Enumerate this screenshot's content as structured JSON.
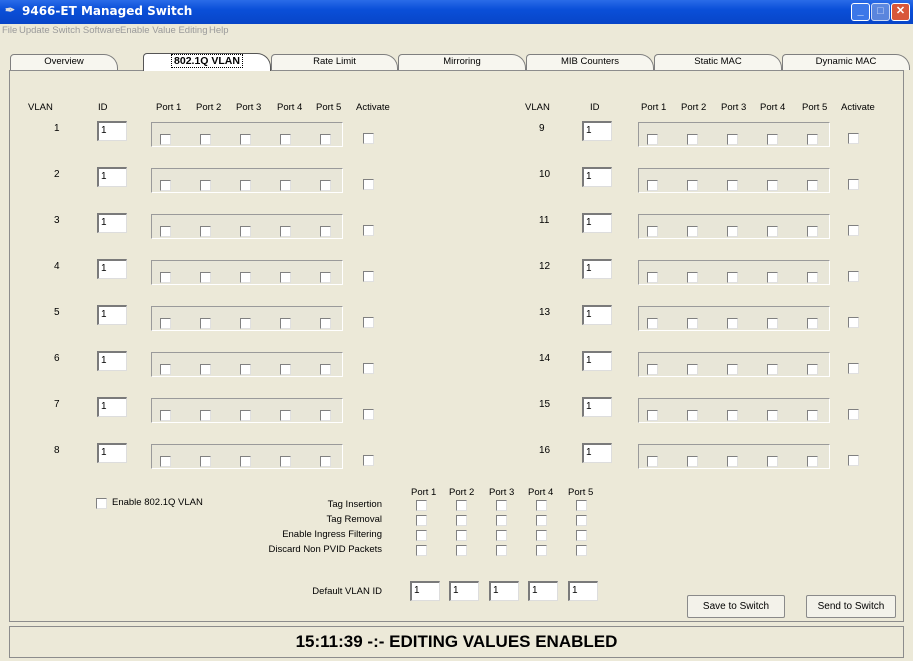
{
  "window": {
    "title": "9466-ET Managed Switch"
  },
  "menu": [
    "File",
    "Update Switch Software",
    "Enable Value Editing",
    "Help"
  ],
  "tabs": [
    "Overview",
    "802.1Q VLAN",
    "Rate Limit",
    "Mirroring",
    "MIB Counters",
    "Static MAC",
    "Dynamic MAC"
  ],
  "active_tab": "802.1Q VLAN",
  "vlan_table": {
    "headers": [
      "VLAN",
      "ID",
      "Port 1",
      "Port 2",
      "Port 3",
      "Port 4",
      "Port 5",
      "Activate"
    ],
    "left_rows": [
      {
        "vlan": "1",
        "id": "1"
      },
      {
        "vlan": "2",
        "id": "1"
      },
      {
        "vlan": "3",
        "id": "1"
      },
      {
        "vlan": "4",
        "id": "1"
      },
      {
        "vlan": "5",
        "id": "1"
      },
      {
        "vlan": "6",
        "id": "1"
      },
      {
        "vlan": "7",
        "id": "1"
      },
      {
        "vlan": "8",
        "id": "1"
      }
    ],
    "right_rows": [
      {
        "vlan": "9",
        "id": "1"
      },
      {
        "vlan": "10",
        "id": "1"
      },
      {
        "vlan": "11",
        "id": "1"
      },
      {
        "vlan": "12",
        "id": "1"
      },
      {
        "vlan": "13",
        "id": "1"
      },
      {
        "vlan": "14",
        "id": "1"
      },
      {
        "vlan": "15",
        "id": "1"
      },
      {
        "vlan": "16",
        "id": "1"
      }
    ]
  },
  "settings": {
    "enable_label": "Enable 802.1Q VLAN",
    "port_headers": [
      "Port 1",
      "Port 2",
      "Port 3",
      "Port 4",
      "Port 5"
    ],
    "rows": [
      "Tag Insertion",
      "Tag Removal",
      "Enable Ingress Filtering",
      "Discard Non PVID Packets"
    ],
    "default_vlan_label": "Default VLAN ID",
    "default_vlan_ids": [
      "1",
      "1",
      "1",
      "1",
      "1"
    ]
  },
  "buttons": {
    "save": "Save to Switch",
    "send": "Send to Switch"
  },
  "status": "15:11:39 -:- EDITING VALUES ENABLED",
  "colors": {
    "titlebar": "#0a4fd8",
    "window_bg": "#ece9d8"
  }
}
